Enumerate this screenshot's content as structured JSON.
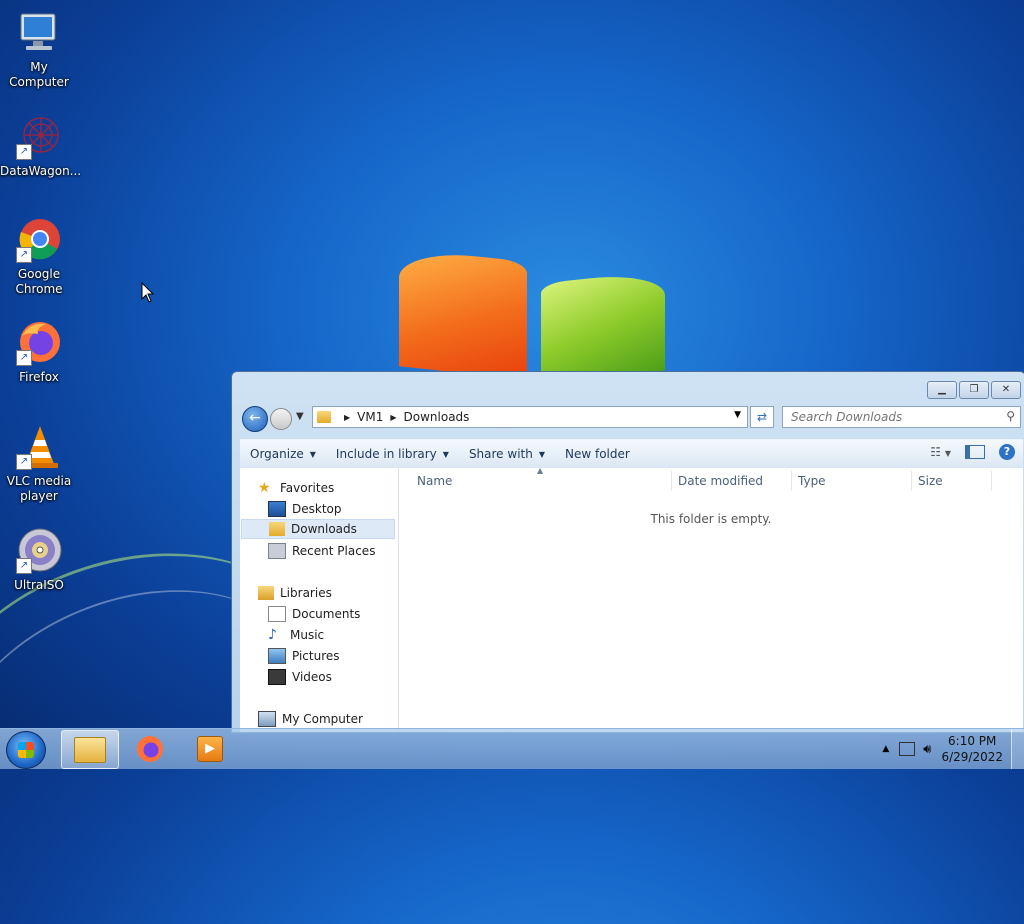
{
  "desktop": {
    "icons": [
      {
        "label": "My Computer",
        "icon": "computer-icon"
      },
      {
        "label": "DataWagon...",
        "icon": "datawagon-icon"
      },
      {
        "label": "Google Chrome",
        "icon": "chrome-icon"
      },
      {
        "label": "Firefox",
        "icon": "firefox-icon"
      },
      {
        "label": "VLC media player",
        "icon": "vlc-icon"
      },
      {
        "label": "UltraISO",
        "icon": "ultraiso-icon"
      }
    ]
  },
  "explorer": {
    "breadcrumb": [
      "VM1",
      "Downloads"
    ],
    "search_placeholder": "Search Downloads",
    "toolbar": {
      "organize": "Organize",
      "include_in_library": "Include in library",
      "share_with": "Share with",
      "new_folder": "New folder"
    },
    "nav": {
      "favorites": "Favorites",
      "desktop": "Desktop",
      "downloads": "Downloads",
      "recent_places": "Recent Places",
      "libraries": "Libraries",
      "documents": "Documents",
      "music": "Music",
      "pictures": "Pictures",
      "videos": "Videos",
      "my_computer": "My Computer"
    },
    "columns": [
      "Name",
      "Date modified",
      "Type",
      "Size"
    ],
    "empty_message": "This folder is empty."
  },
  "taskbar": {
    "time": "6:10 PM",
    "date": "6/29/2022"
  },
  "colors": {
    "accent": "#1c5fb8",
    "selection": "#dde9f6"
  }
}
